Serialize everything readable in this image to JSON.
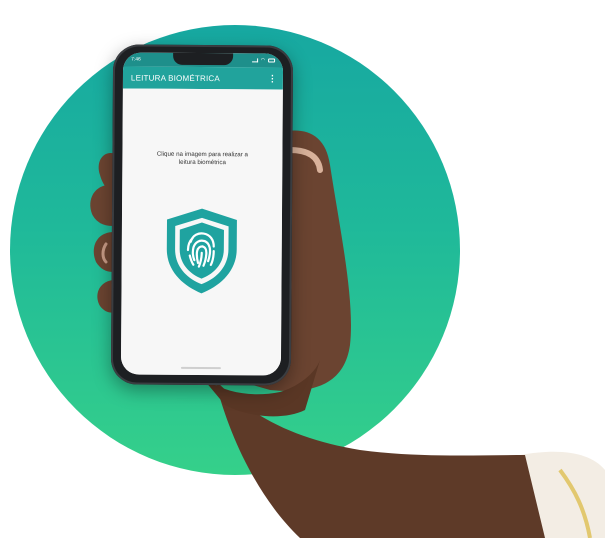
{
  "status_bar": {
    "time": "7:46"
  },
  "app_bar": {
    "title": "LEITURA BIOMÉTRICA",
    "menu_glyph": "⋮"
  },
  "content": {
    "instruction_line1": "Clique na imagem para realizar a",
    "instruction_line2": "leitura biométrica"
  },
  "icons": {
    "main": "shield-fingerprint-icon",
    "menu": "more-vert-icon"
  },
  "colors": {
    "circle_top": "#17a8a1",
    "circle_bottom": "#35d08a",
    "app_bar": "#21a39c",
    "status_bar": "#1e8f8b",
    "shield": "#1fa3a0"
  }
}
